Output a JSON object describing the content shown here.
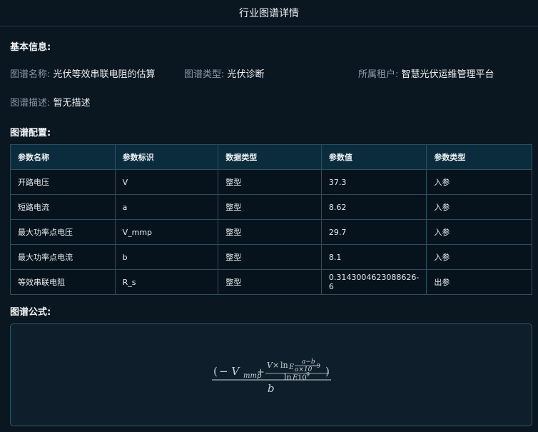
{
  "header": {
    "title": "行业图谱详情"
  },
  "basic": {
    "section_title": "基本信息:",
    "name_label": "图谱名称:",
    "name_value": "光伏等效串联电阻的估算",
    "type_label": "图谱类型:",
    "type_value": "光伏诊断",
    "tenant_label": "所属租户:",
    "tenant_value": "智慧光伏运维管理平台",
    "desc_label": "图谱描述:",
    "desc_value": "暂无描述"
  },
  "config": {
    "section_title": "图谱配置:",
    "columns": [
      "参数名称",
      "参数标识",
      "数据类型",
      "参数值",
      "参数类型"
    ],
    "rows": [
      [
        "开路电压",
        "V",
        "整型",
        "37.3",
        "入参"
      ],
      [
        "短路电流",
        "a",
        "整型",
        "8.62",
        "入参"
      ],
      [
        "最大功率点电压",
        "V_mmp",
        "整型",
        "29.7",
        "入参"
      ],
      [
        "最大功率点电流",
        "b",
        "整型",
        "8.1",
        "入参"
      ],
      [
        "等效串联电阻",
        "R_s",
        "整型",
        "0.3143004623088626­6",
        "出参"
      ]
    ]
  },
  "formula": {
    "section_title": "图谱公式:",
    "open_paren": "(",
    "minus_v": "− V",
    "sub_mmp": "mmp",
    "plus": "+",
    "num_v": "V×",
    "ln1": "ln",
    "e1": "E",
    "frac_num": "a−b",
    "frac_den": "a×10",
    "exp1": "−9",
    "ln2": "ln",
    "e2": "E",
    "ten": "10",
    "exp2": "9",
    "close_paren": ")",
    "denom_b": "b"
  }
}
